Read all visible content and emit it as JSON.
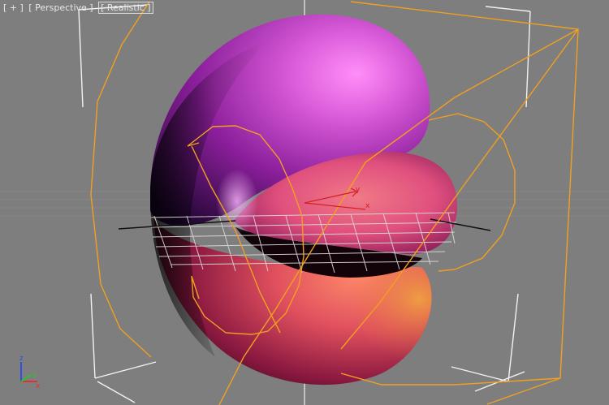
{
  "viewport": {
    "menu": {
      "plus": "[ + ]",
      "view": "[ Perspective ]",
      "shading": "[ Realistic ]"
    },
    "gizmo_axis_labels": {
      "x": "x",
      "y": "y"
    },
    "view_cube_axes": {
      "x": "x",
      "y": "y",
      "z": "z"
    }
  },
  "colors": {
    "background": "#7e7e7e",
    "selection_orange": "#f0a020",
    "bounding_white": "#f2f2f2",
    "grid": "#d0d0d0",
    "gizmo_red": "#d02020",
    "axis_x": "#e03030",
    "axis_y": "#30c030",
    "axis_z": "#3050e0"
  },
  "icons": [
    "x-axis-icon",
    "y-axis-icon",
    "z-axis-icon"
  ]
}
